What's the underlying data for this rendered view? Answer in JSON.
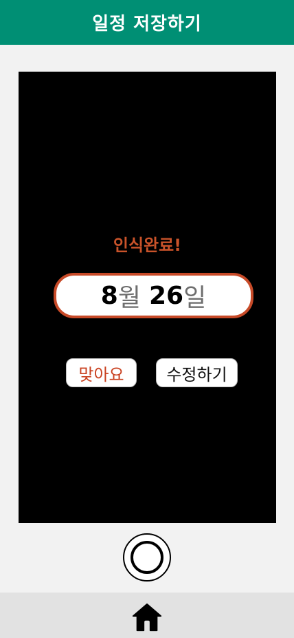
{
  "header": {
    "title": "일정 저장하기"
  },
  "recognition": {
    "status": "인식완료!",
    "date": {
      "month": "8",
      "month_unit": "월",
      "day": "26",
      "day_unit": "일"
    }
  },
  "actions": {
    "confirm_label": "맞아요",
    "edit_label": "수정하기"
  },
  "icons": {
    "shutter": "camera-shutter-icon",
    "home": "home-icon"
  },
  "colors": {
    "header_bg": "#008f74",
    "accent": "#c74a28",
    "camera_bg": "#000000",
    "nav_bg": "#e2e2e2"
  }
}
